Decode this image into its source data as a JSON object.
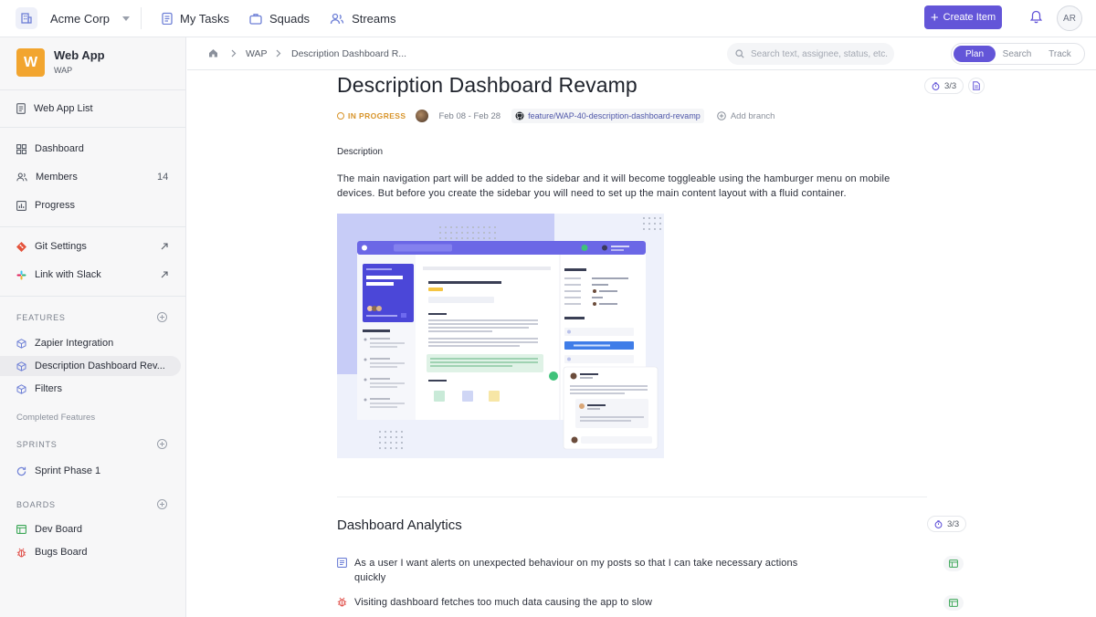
{
  "topbar": {
    "org_name": "Acme Corp",
    "nav": [
      {
        "label": "My Tasks",
        "icon": "clipboard-icon"
      },
      {
        "label": "Squads",
        "icon": "briefcase-icon"
      },
      {
        "label": "Streams",
        "icon": "users-stream-icon"
      }
    ],
    "create_label": "Create Item",
    "avatar_initials": "AR"
  },
  "sidebar": {
    "project_logo_letter": "W",
    "project_name": "Web App",
    "project_key": "WAP",
    "list_label": "Web App List",
    "menu": [
      {
        "label": "Dashboard",
        "icon": "dashboard-icon"
      },
      {
        "label": "Members",
        "icon": "members-icon",
        "count": "14"
      },
      {
        "label": "Progress",
        "icon": "progress-chart-icon"
      }
    ],
    "integrations": [
      {
        "label": "Git Settings",
        "icon": "git-icon"
      },
      {
        "label": "Link with Slack",
        "icon": "slack-icon"
      }
    ],
    "features_heading": "FEATURES",
    "features": [
      {
        "label": "Zapier Integration"
      },
      {
        "label": "Description Dashboard Rev..."
      },
      {
        "label": "Filters"
      }
    ],
    "completed_label": "Completed Features",
    "sprints_heading": "SPRINTS",
    "sprints": [
      {
        "label": "Sprint Phase 1"
      }
    ],
    "boards_heading": "BOARDS",
    "boards": [
      {
        "label": "Dev Board",
        "color": "#3aa655"
      },
      {
        "label": "Bugs Board",
        "color": "#e0504a"
      }
    ]
  },
  "breadcrumb": {
    "items": [
      "WAP",
      "Description Dashboard R..."
    ]
  },
  "search": {
    "placeholder": "Search text, assignee, status, etc."
  },
  "view_toggle": [
    "Plan",
    "Search",
    "Track"
  ],
  "feature": {
    "title": "Description Dashboard Revamp",
    "progress": "3/3",
    "status": "IN PROGRESS",
    "status_color": "#d8942a",
    "dates": "Feb 08 - Feb 28",
    "branch": "feature/WAP-40-description-dashboard-revamp",
    "add_branch_label": "Add branch",
    "description_label": "Description",
    "description_text": "The main navigation part will be added to the sidebar and it will become toggleable using the hamburger menu on mobile devices. But before you create the sidebar you will need to set up the main content layout with a fluid container.",
    "attachment_image": "dashboard-preview-image"
  },
  "analytics": {
    "title": "Dashboard Analytics",
    "progress": "3/3",
    "items": [
      {
        "type": "story",
        "text": "As a user I want alerts on unexpected behaviour on my posts so that I can take necessary actions quickly"
      },
      {
        "type": "bug",
        "text": "Visiting dashboard fetches too much data causing the app to slow"
      }
    ]
  },
  "colors": {
    "accent": "#6355d8",
    "brand_logo": "#f2a52f"
  }
}
